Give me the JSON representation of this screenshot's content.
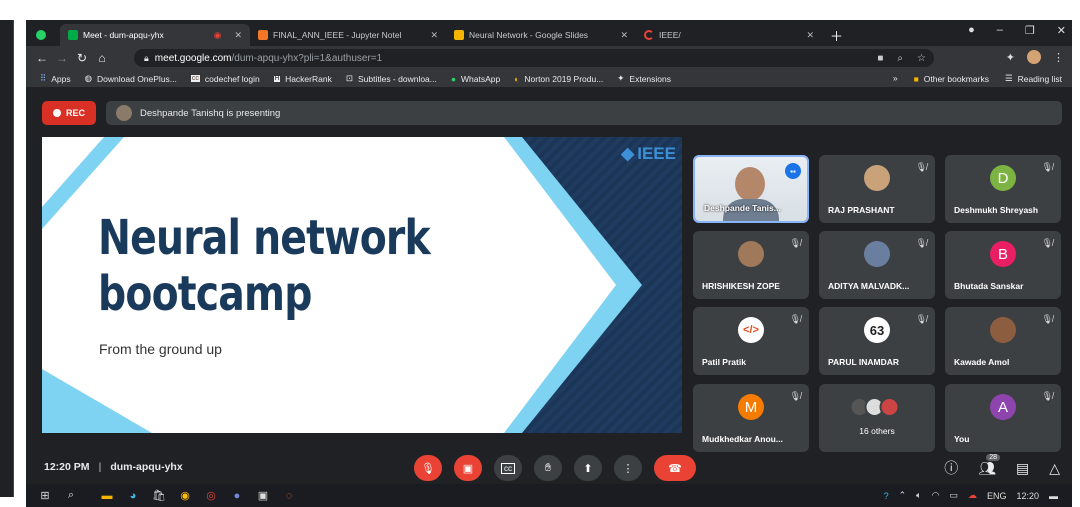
{
  "browser": {
    "tabs": [
      {
        "title": "Meet - dum-apqu-yhx",
        "active": true,
        "favicon": "meet-icon",
        "color": "#00ac47"
      },
      {
        "title": "FINAL_ANN_IEEE - Jupyter Notel",
        "active": false,
        "favicon": "jupyter-icon",
        "color": "#f37726"
      },
      {
        "title": "Neural Network - Google Slides",
        "active": false,
        "favicon": "slides-icon",
        "color": "#f4b400"
      },
      {
        "title": "IEEE/",
        "active": false,
        "favicon": "loading-icon",
        "color": "#ea4335"
      }
    ],
    "url_host": "meet.google.com",
    "url_path": "/dum-apqu-yhx?pli=1&authuser=1",
    "bookmarks": [
      "Apps",
      "Download OnePlus...",
      "codechef login",
      "HackerRank",
      "Subtitles - downloa...",
      "WhatsApp",
      "Norton 2019 Produ...",
      "Extensions"
    ],
    "bookmarks_more": "»",
    "other_bookmarks": "Other bookmarks",
    "reading_list": "Reading list"
  },
  "meet": {
    "rec_label": "REC",
    "presenting_text": "Deshpande Tanishq is presenting",
    "slide": {
      "title_line1": "Neural network",
      "title_line2": "bootcamp",
      "subtitle": "From the ground up",
      "logo_text": "IEEE"
    },
    "participants": [
      {
        "name": "Deshpande Tanis...",
        "avatar_type": "video",
        "speaking": true
      },
      {
        "name": "RAJ PRASHANT",
        "avatar_type": "photo",
        "color": "#c9a27a"
      },
      {
        "name": "Deshmukh Shreyash",
        "avatar_type": "letter",
        "letter": "D",
        "color": "#7cb342"
      },
      {
        "name": "HRISHIKESH ZOPE",
        "avatar_type": "photo",
        "color": "#a0785a"
      },
      {
        "name": "ADITYA MALVADK...",
        "avatar_type": "photo",
        "color": "#6a7fa0"
      },
      {
        "name": "Bhutada Sanskar",
        "avatar_type": "letter",
        "letter": "B",
        "color": "#e91e63"
      },
      {
        "name": "Patil Pratik",
        "avatar_type": "code",
        "color": "#ffffff"
      },
      {
        "name": "PARUL INAMDAR",
        "avatar_type": "number",
        "letter": "63",
        "color": "#ffffff"
      },
      {
        "name": "Kawade Amol",
        "avatar_type": "photo",
        "color": "#8d5d3f"
      },
      {
        "name": "Mudkhedkar Anou...",
        "avatar_type": "letter",
        "letter": "M",
        "color": "#f57c00"
      },
      {
        "name": "16 others",
        "avatar_type": "others"
      },
      {
        "name": "You",
        "avatar_type": "letter",
        "letter": "A",
        "color": "#8e44ad"
      }
    ],
    "time": "12:20 PM",
    "meeting_code": "dum-apqu-yhx",
    "people_count": "28"
  },
  "taskbar": {
    "language": "ENG",
    "clock": "12:20"
  }
}
